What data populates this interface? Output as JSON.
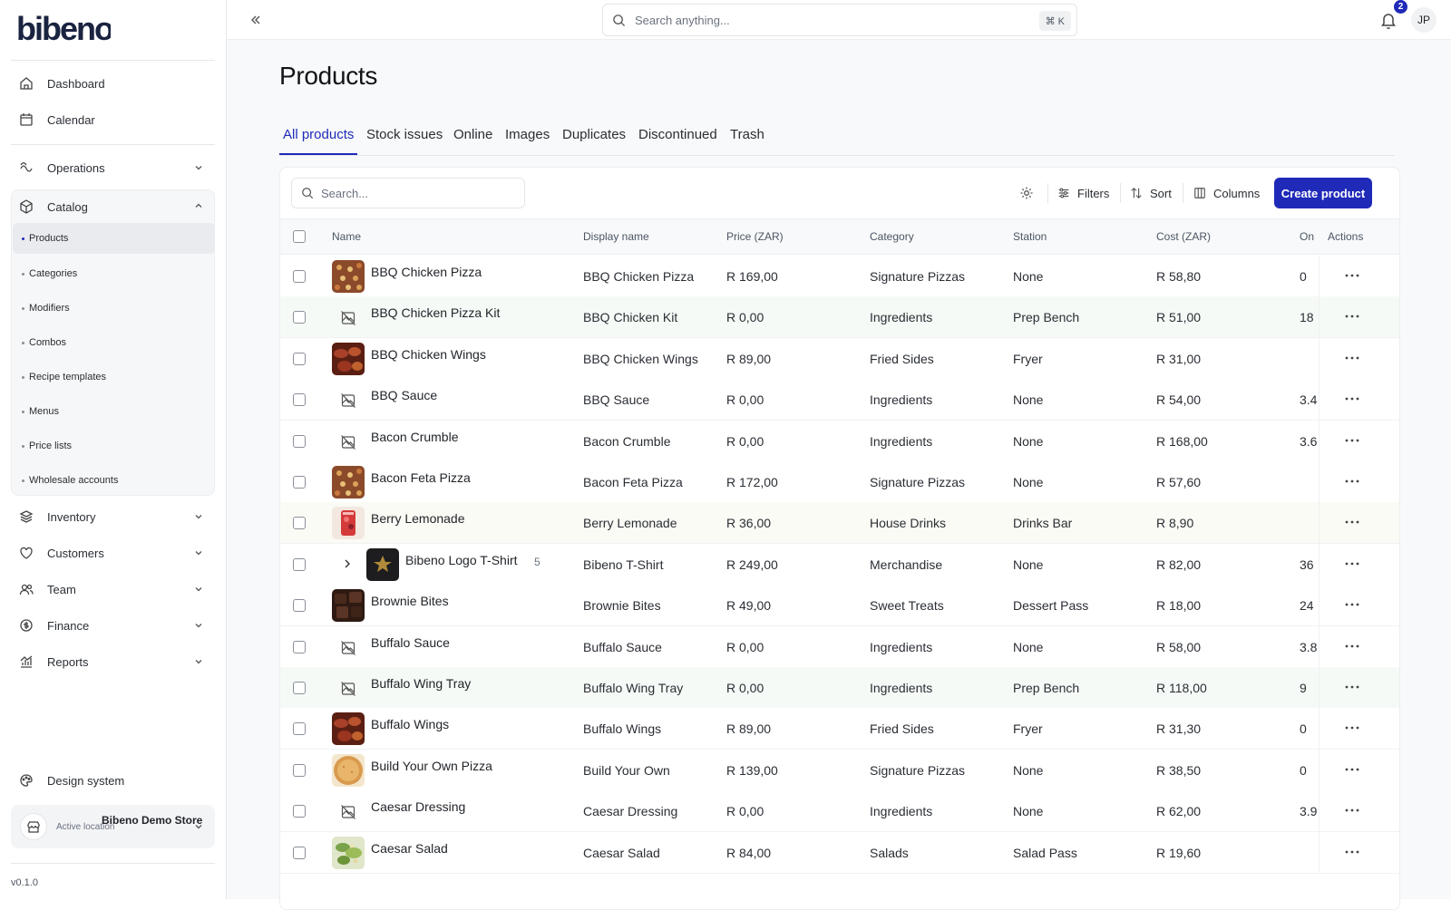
{
  "app": {
    "brand": "bibeno",
    "version": "v0.1.0"
  },
  "sidebar": {
    "top_items": [
      {
        "label": "Dashboard",
        "icon": "home-icon"
      },
      {
        "label": "Calendar",
        "icon": "calendar-icon"
      }
    ],
    "groups": [
      {
        "label": "Operations",
        "icon": "operations-icon"
      },
      {
        "label": "Catalog",
        "icon": "package-icon",
        "expanded": true
      }
    ],
    "catalog_items": [
      "Products",
      "Categories",
      "Modifiers",
      "Combos",
      "Recipe templates",
      "Menus",
      "Price lists",
      "Wholesale accounts"
    ],
    "lower_groups": [
      {
        "label": "Inventory",
        "icon": "inventory-icon"
      },
      {
        "label": "Customers",
        "icon": "customers-icon"
      },
      {
        "label": "Team",
        "icon": "team-icon"
      },
      {
        "label": "Finance",
        "icon": "finance-icon"
      },
      {
        "label": "Reports",
        "icon": "reports-icon"
      }
    ],
    "design_system": "Design system",
    "store": {
      "name": "Bibeno Demo Store",
      "sub": "Active location"
    }
  },
  "topbar": {
    "search_placeholder": "Search anything...",
    "shortcut": "⌘ K",
    "notifications": "2",
    "user_initials": "JP"
  },
  "page": {
    "title": "Products",
    "tabs": [
      "All products",
      "Stock issues",
      "Online",
      "Images",
      "Duplicates",
      "Discontinued",
      "Trash"
    ],
    "active_tab": "All products"
  },
  "toolbar": {
    "search_placeholder": "Search...",
    "filters": "Filters",
    "sort": "Sort",
    "columns": "Columns",
    "create": "Create product"
  },
  "table": {
    "headers": {
      "name": "Name",
      "display": "Display name",
      "price": "Price (ZAR)",
      "category": "Category",
      "station": "Station",
      "cost": "Cost (ZAR)",
      "onhand": "On hand",
      "actions": "Actions"
    },
    "rows": [
      {
        "name": "BBQ Chicken Pizza",
        "display": "BBQ Chicken Pizza",
        "price": "R 169,00",
        "category": "Signature Pizzas",
        "station": "None",
        "cost": "R 58,80",
        "onhand": "0",
        "img": "pizza"
      },
      {
        "name": "BBQ Chicken Pizza Kit",
        "display": "BBQ Chicken Kit",
        "price": "R 0,00",
        "category": "Ingredients",
        "station": "Prep Bench",
        "cost": "R 51,00",
        "onhand": "18",
        "img": "none"
      },
      {
        "name": "BBQ Chicken Wings",
        "display": "BBQ Chicken Wings",
        "price": "R 89,00",
        "category": "Fried Sides",
        "station": "Fryer",
        "cost": "R 31,00",
        "onhand": "",
        "img": "wings"
      },
      {
        "name": "BBQ Sauce",
        "display": "BBQ Sauce",
        "price": "R 0,00",
        "category": "Ingredients",
        "station": "None",
        "cost": "R 54,00",
        "onhand": "3.4",
        "img": "none"
      },
      {
        "name": "Bacon Crumble",
        "display": "Bacon Crumble",
        "price": "R 0,00",
        "category": "Ingredients",
        "station": "None",
        "cost": "R 168,00",
        "onhand": "3.6",
        "img": "none"
      },
      {
        "name": "Bacon Feta Pizza",
        "display": "Bacon Feta Pizza",
        "price": "R 172,00",
        "category": "Signature Pizzas",
        "station": "None",
        "cost": "R 57,60",
        "onhand": "",
        "img": "pizza"
      },
      {
        "name": "Berry Lemonade",
        "display": "Berry Lemonade",
        "price": "R 36,00",
        "category": "House Drinks",
        "station": "Drinks Bar",
        "cost": "R 8,90",
        "onhand": "",
        "img": "drink"
      },
      {
        "name": "Bibeno Logo T-Shirt",
        "display": "Bibeno T-Shirt",
        "price": "R 249,00",
        "category": "Merchandise",
        "station": "None",
        "cost": "R 82,00",
        "onhand": "36",
        "img": "shirt",
        "variants": "5"
      },
      {
        "name": "Brownie Bites",
        "display": "Brownie Bites",
        "price": "R 49,00",
        "category": "Sweet Treats",
        "station": "Dessert Pass",
        "cost": "R 18,00",
        "onhand": "24",
        "img": "brownie"
      },
      {
        "name": "Buffalo Sauce",
        "display": "Buffalo Sauce",
        "price": "R 0,00",
        "category": "Ingredients",
        "station": "None",
        "cost": "R 58,00",
        "onhand": "3.8",
        "img": "none"
      },
      {
        "name": "Buffalo Wing Tray",
        "display": "Buffalo Wing Tray",
        "price": "R 0,00",
        "category": "Ingredients",
        "station": "Prep Bench",
        "cost": "R 118,00",
        "onhand": "9",
        "img": "none"
      },
      {
        "name": "Buffalo Wings",
        "display": "Buffalo Wings",
        "price": "R 89,00",
        "category": "Fried Sides",
        "station": "Fryer",
        "cost": "R 31,30",
        "onhand": "0",
        "img": "wings"
      },
      {
        "name": "Build Your Own Pizza",
        "display": "Build Your Own",
        "price": "R 139,00",
        "category": "Signature Pizzas",
        "station": "None",
        "cost": "R 38,50",
        "onhand": "0",
        "img": "plainpizza"
      },
      {
        "name": "Caesar Dressing",
        "display": "Caesar Dressing",
        "price": "R 0,00",
        "category": "Ingredients",
        "station": "None",
        "cost": "R 62,00",
        "onhand": "3.9",
        "img": "none"
      },
      {
        "name": "Caesar Salad",
        "display": "Caesar Salad",
        "price": "R 84,00",
        "category": "Salads",
        "station": "Salad Pass",
        "cost": "R 19,60",
        "onhand": "",
        "img": "salad"
      }
    ]
  }
}
